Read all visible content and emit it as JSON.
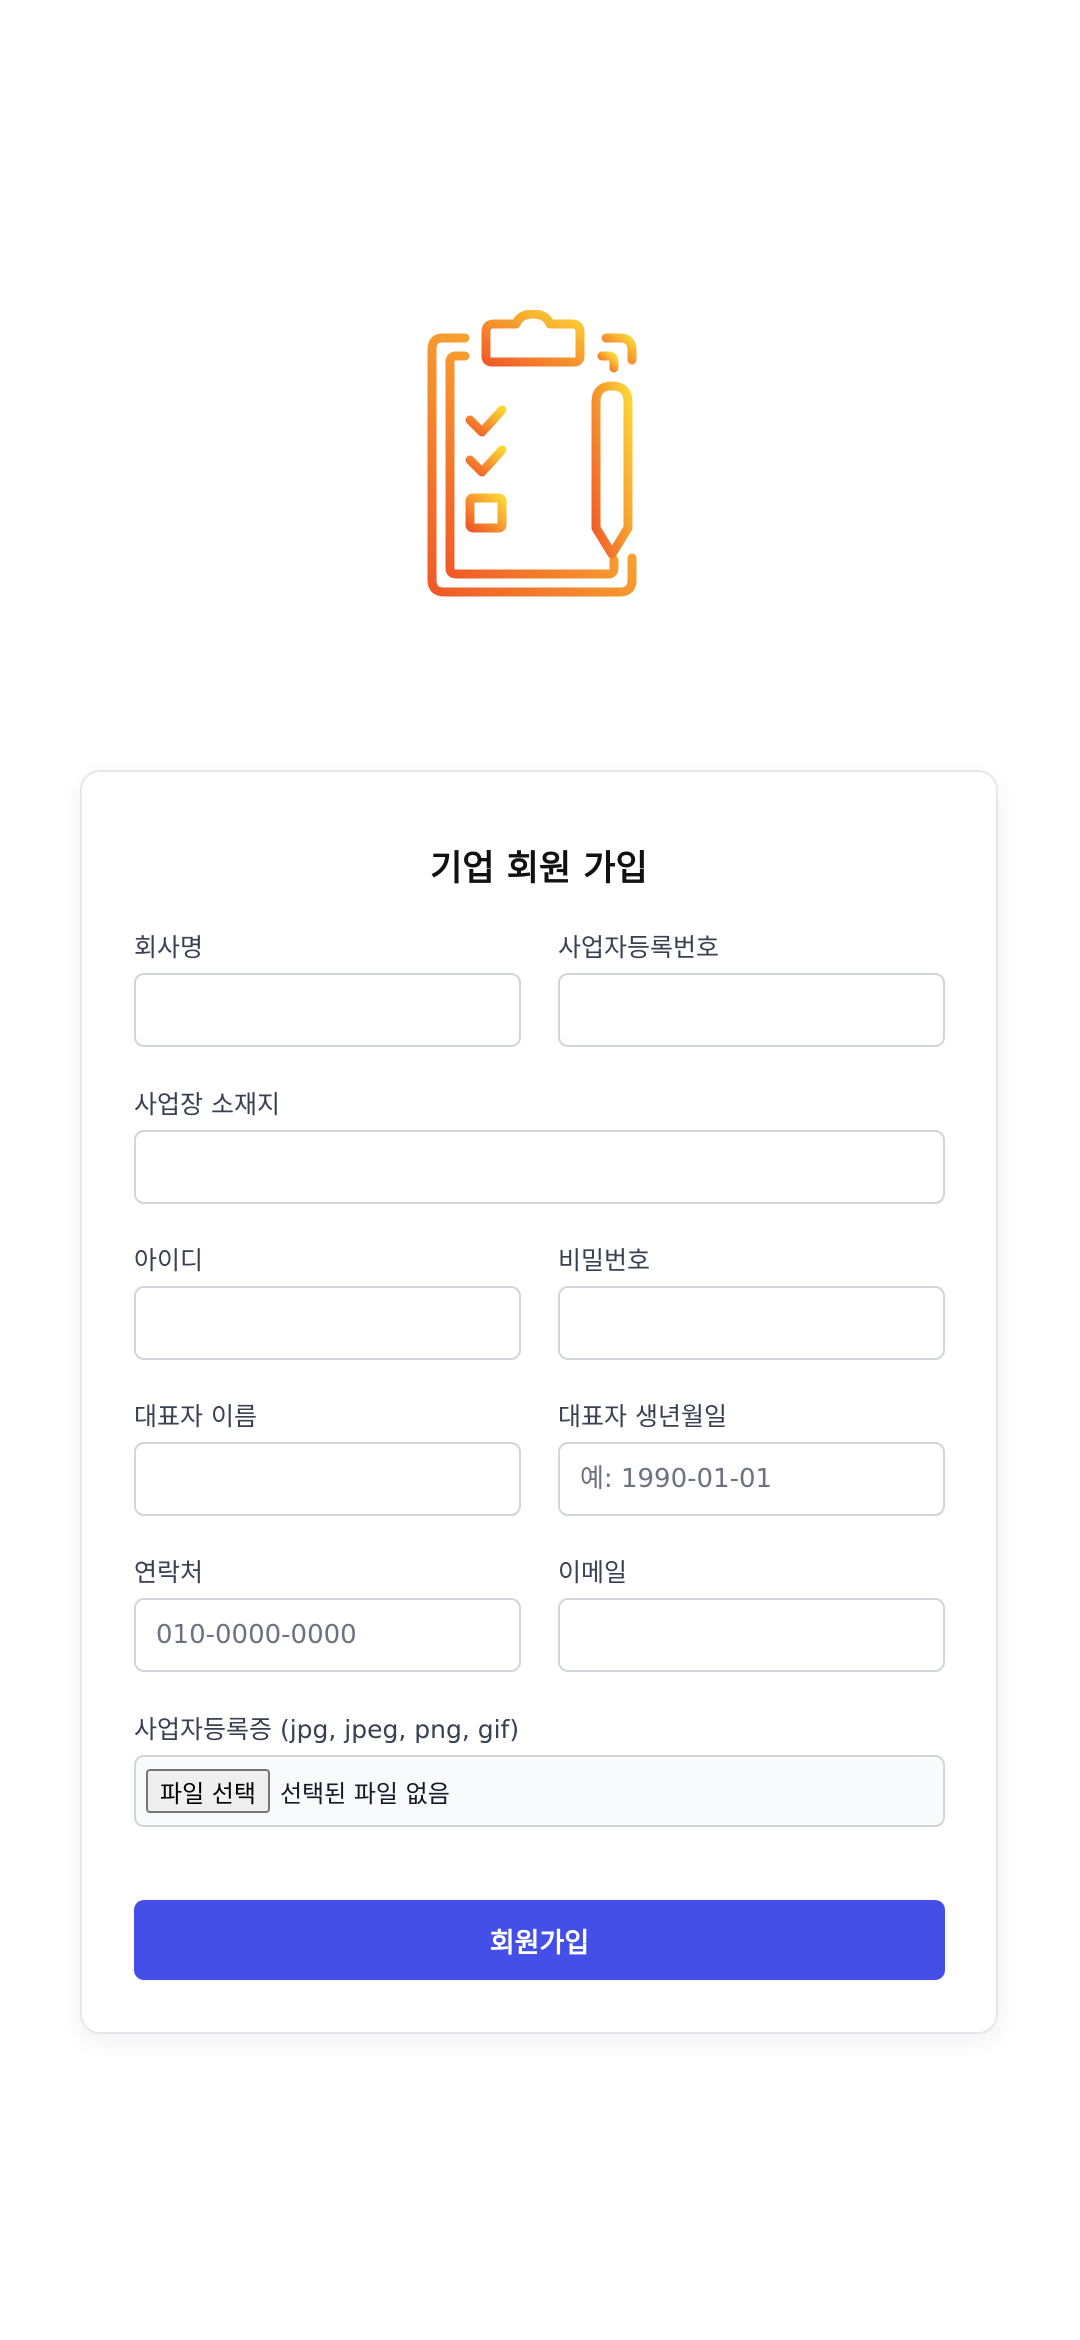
{
  "logo": {
    "icon": "clipboard-checklist-icon",
    "gradient_start": "#f05a28",
    "gradient_end": "#fcd535"
  },
  "form": {
    "title": "기업 회원 가입",
    "fields": {
      "company_name": {
        "label": "회사명",
        "value": "",
        "placeholder": ""
      },
      "business_number": {
        "label": "사업자등록번호",
        "value": "",
        "placeholder": ""
      },
      "business_address": {
        "label": "사업장 소재지",
        "value": "",
        "placeholder": ""
      },
      "user_id": {
        "label": "아이디",
        "value": "",
        "placeholder": ""
      },
      "password": {
        "label": "비밀번호",
        "value": "",
        "placeholder": ""
      },
      "ceo_name": {
        "label": "대표자 이름",
        "value": "",
        "placeholder": ""
      },
      "ceo_birthdate": {
        "label": "대표자 생년월일",
        "value": "",
        "placeholder": "예: 1990-01-01"
      },
      "phone": {
        "label": "연락처",
        "value": "",
        "placeholder": "010-0000-0000"
      },
      "email": {
        "label": "이메일",
        "value": "",
        "placeholder": ""
      }
    },
    "file": {
      "label": "사업자등록증 (jpg, jpeg, png, gif)",
      "button_label": "파일 선택",
      "status": "선택된 파일 없음"
    },
    "submit_label": "회원가입",
    "accent_color": "#434fe6"
  }
}
